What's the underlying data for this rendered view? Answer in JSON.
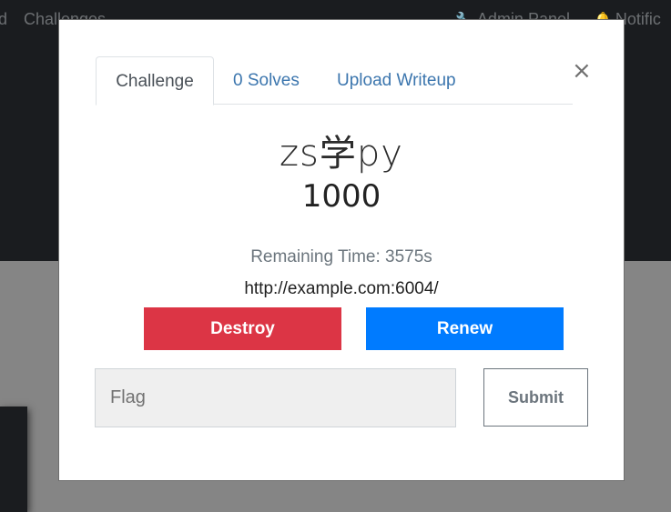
{
  "background": {
    "nav": {
      "left_item_fragment": "d",
      "challenges_label": "Challenges",
      "admin_panel_label": "Admin Panel",
      "notifications_label": "Notific"
    }
  },
  "modal": {
    "close_glyph": "×",
    "tabs": [
      {
        "label": "Challenge",
        "active": true
      },
      {
        "label": "0 Solves",
        "active": false
      },
      {
        "label": "Upload Writeup",
        "active": false
      }
    ],
    "challenge_name": "zs学py",
    "challenge_value": "1000",
    "remaining_time": "Remaining Time: 3575s",
    "instance_url": "http://example.com:6004/",
    "destroy_label": "Destroy",
    "renew_label": "Renew",
    "flag_placeholder": "Flag",
    "submit_label": "Submit"
  },
  "colors": {
    "destroy": "#dc3545",
    "renew": "#007bff",
    "tab_link": "#3c76ae"
  },
  "icons": {
    "admin_panel": "wrench-icon",
    "notifications": "bell-icon",
    "close": "close-icon"
  }
}
